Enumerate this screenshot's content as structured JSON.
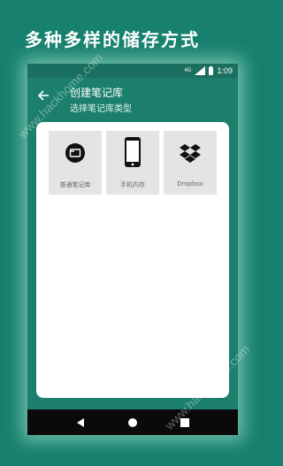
{
  "promo": {
    "title": "多种多样的储存方式"
  },
  "status_bar": {
    "signal_label": "4G",
    "time": "1:09"
  },
  "app_bar": {
    "title": "创建笔记库",
    "subtitle": "选择笔记库类型"
  },
  "storage_options": [
    {
      "label": "普通笔记库",
      "icon": "folder-icon"
    },
    {
      "label": "手机内存",
      "icon": "phone-icon"
    },
    {
      "label": "Dropbox",
      "icon": "dropbox-icon"
    }
  ],
  "watermark": {
    "text": "www.hackhome.com"
  },
  "colors": {
    "background": "#17806e",
    "status_bar": "#1b6f60",
    "app_bar": "#1c7f6d",
    "card": "#ffffff",
    "option_tile": "#e4e4e4",
    "nav_bar": "#0a0a0a"
  }
}
